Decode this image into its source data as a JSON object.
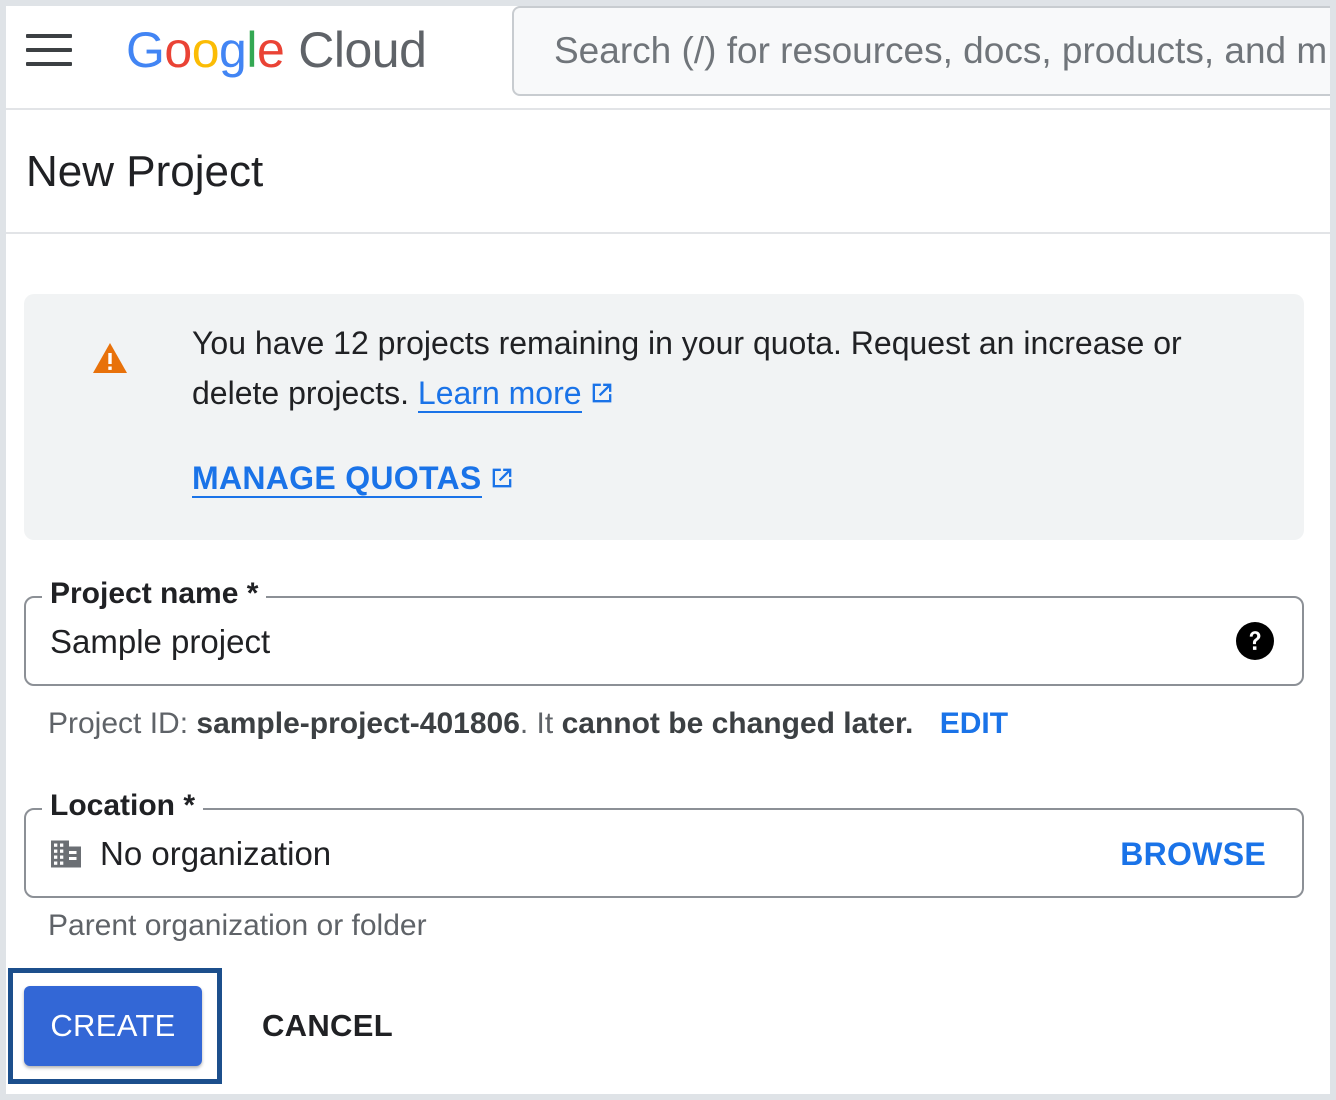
{
  "topbar": {
    "logo": {
      "g1": "G",
      "g2": "o",
      "g3": "o",
      "g4": "g",
      "g5": "l",
      "g6": "e",
      "product": "Cloud"
    },
    "search_placeholder": "Search (/) for resources, docs, products, and m"
  },
  "page": {
    "title": "New Project"
  },
  "banner": {
    "message": "You have 12 projects remaining in your quota. Request an increase or delete projects.",
    "learn_more": "Learn more",
    "manage_quotas": "MANAGE QUOTAS",
    "icon": "warning-icon"
  },
  "project_name": {
    "label": "Project name *",
    "value": "Sample project",
    "help_icon": "help-icon"
  },
  "project_id_hint": {
    "prefix": "Project ID:",
    "id": "sample-project-401806",
    "middle": ". It",
    "suffix": "cannot be changed later.",
    "edit": "EDIT"
  },
  "location": {
    "label": "Location *",
    "value": "No organization",
    "browse": "BROWSE",
    "hint": "Parent organization or folder",
    "icon": "organization-icon"
  },
  "actions": {
    "create": "CREATE",
    "cancel": "CANCEL"
  },
  "colors": {
    "link_blue": "#1a73e8",
    "create_button": "#3367d6",
    "highlight_border": "#1c4f8c",
    "warning_orange": "#e8710a",
    "banner_bg": "#f1f3f4"
  }
}
